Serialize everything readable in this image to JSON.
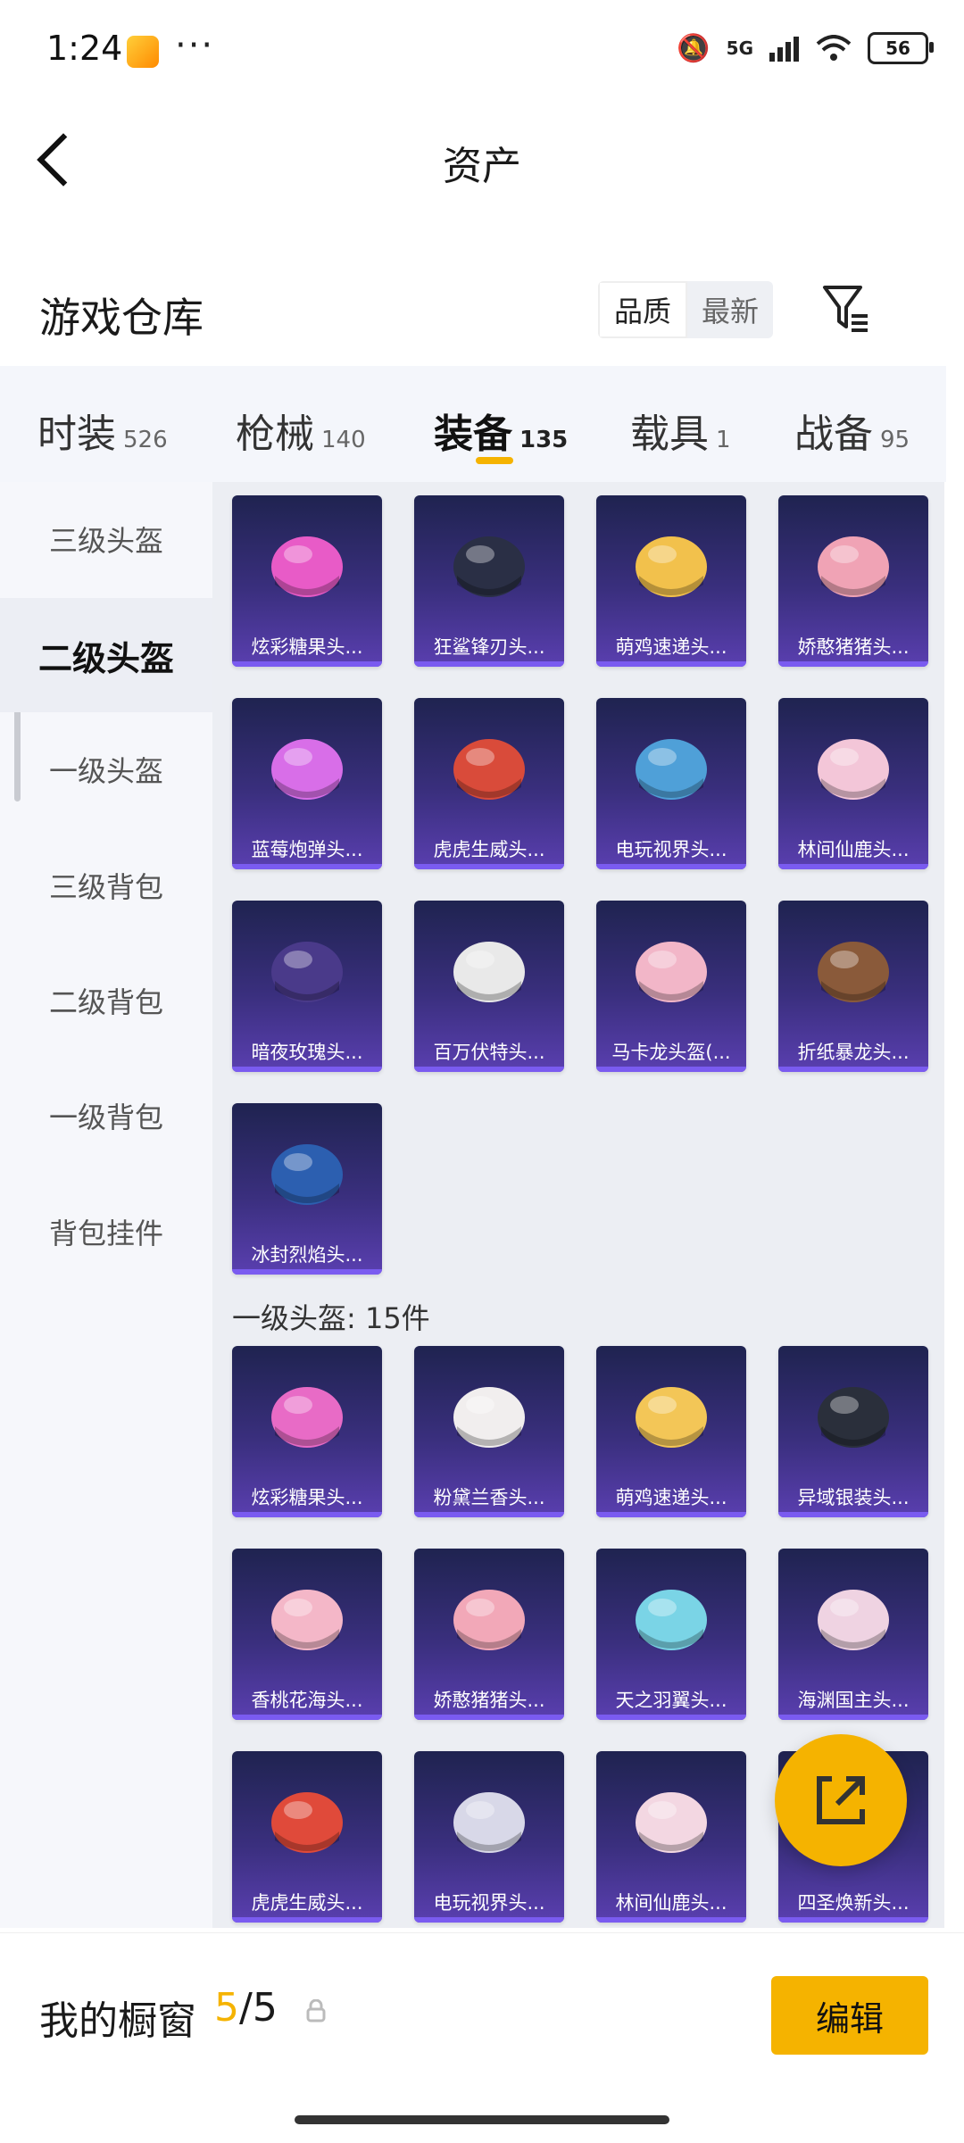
{
  "status": {
    "time": "1:24",
    "more": "···",
    "network": "5G",
    "battery": "56"
  },
  "header": {
    "title": "资产"
  },
  "section": {
    "title": "游戏仓库",
    "sort_quality": "品质",
    "sort_newest": "最新"
  },
  "tabs": [
    {
      "label": "时装",
      "count": "526"
    },
    {
      "label": "枪械",
      "count": "140"
    },
    {
      "label": "装备",
      "count": "135"
    },
    {
      "label": "载具",
      "count": "1"
    },
    {
      "label": "战备",
      "count": "95"
    }
  ],
  "sidebar": [
    "三级头盔",
    "二级头盔",
    "一级头盔",
    "三级背包",
    "二级背包",
    "一级背包",
    "背包挂件"
  ],
  "group1": {
    "items": [
      "炫彩糖果头...",
      "狂鲨锋刃头...",
      "萌鸡速递头...",
      "娇憨猪猪头...",
      "蓝莓炮弹头...",
      "虎虎生威头...",
      "电玩视界头...",
      "林间仙鹿头...",
      "暗夜玫瑰头...",
      "百万伏特头...",
      "马卡龙头盔(...",
      "折纸暴龙头...",
      "冰封烈焰头..."
    ]
  },
  "group2": {
    "label": "一级头盔: 15件",
    "items": [
      "炫彩糖果头...",
      "粉黛兰香头...",
      "萌鸡速递头...",
      "异域银装头...",
      "香桃花海头...",
      "娇憨猪猪头...",
      "天之羽翼头...",
      "海渊国主头...",
      "虎虎生威头...",
      "电玩视界头...",
      "林间仙鹿头...",
      "四圣焕新头..."
    ]
  },
  "colors": {
    "accent": "#f5b300",
    "helmets1": [
      "#e85bc7",
      "#2a2f45",
      "#f2c14c",
      "#f0a3b5",
      "#d86ee8",
      "#d94b3a",
      "#4fa0d8",
      "#f3c6d8",
      "#4a3a8a",
      "#e9e9e9",
      "#f2b6c8",
      "#8a5a3a",
      "#2c5fb0"
    ],
    "helmets2": [
      "#e86bc6",
      "#f1eeee",
      "#f3c657",
      "#2a2f3b",
      "#f4b7c8",
      "#f2a8b8",
      "#7ad4e6",
      "#efd3e2",
      "#e04a3a",
      "#d8d8e8",
      "#f3d7e2",
      "#e64a6e"
    ]
  },
  "bottom": {
    "label": "我的橱窗",
    "current": "5",
    "total": "/5",
    "edit": "编辑"
  }
}
